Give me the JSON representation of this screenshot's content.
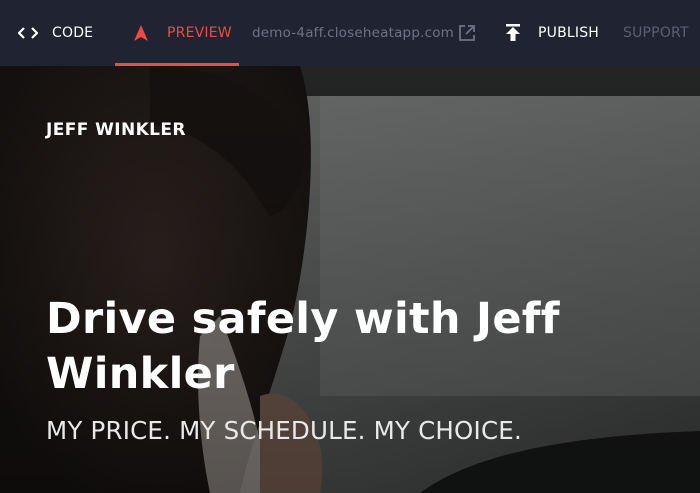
{
  "toolbar": {
    "code_label": "CODE",
    "preview_label": "PREVIEW",
    "url": "demo-4aff.closeheatapp.com",
    "publish_label": "PUBLISH",
    "support_label": "SUPPORT"
  },
  "hero": {
    "brand": "JEFF WINKLER",
    "headline": "Drive safely with Jeff Winkler",
    "tagline": "MY PRICE. MY SCHEDULE. MY CHOICE."
  },
  "icons": {
    "code": "code-brackets-icon",
    "preview": "arrow-up-icon",
    "external": "external-link-icon",
    "publish": "upload-icon"
  },
  "colors": {
    "topbar": "#1f2332",
    "accent": "#ee4b44",
    "muted_text": "#6e7384"
  }
}
